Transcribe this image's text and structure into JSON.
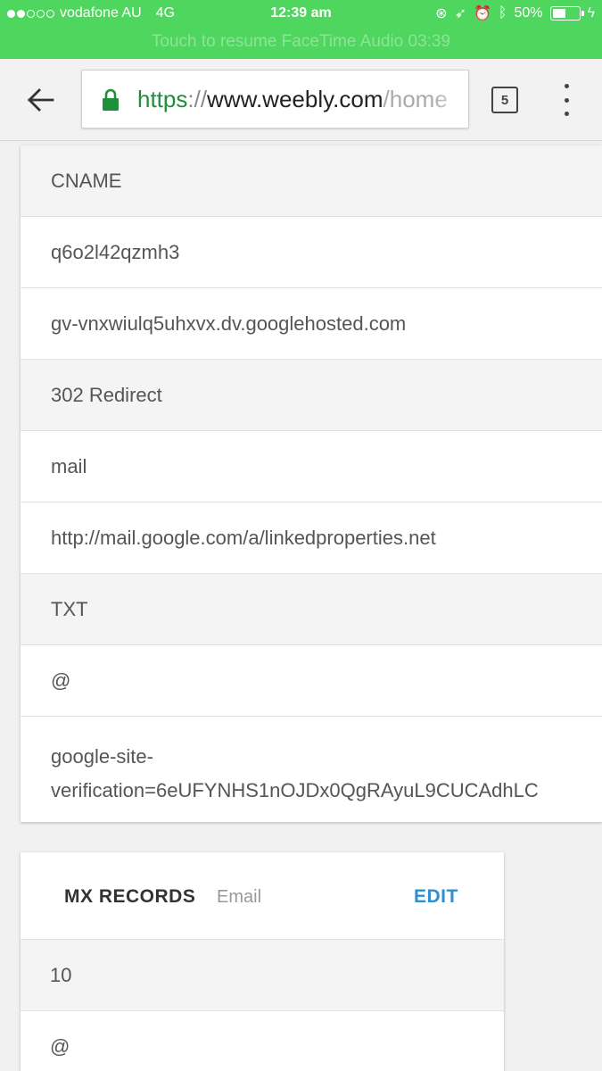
{
  "status_bar": {
    "carrier": "vodafone AU",
    "network": "4G",
    "time": "12:39 am",
    "battery_text": "50%",
    "battery_level": 0.5,
    "banner": "Touch to resume FaceTime Audio 03:39"
  },
  "browser": {
    "url_scheme": "https",
    "url_sep": "://",
    "url_host": "www.weebly.com",
    "url_path": "/home",
    "tab_count": "5"
  },
  "dns_records": [
    {
      "value": "CNAME",
      "shaded": true
    },
    {
      "value": "q6o2l42qzmh3",
      "shaded": false
    },
    {
      "value": "gv-vnxwiulq5uhxvx.dv.googlehosted.com",
      "shaded": false
    },
    {
      "value": "302 Redirect",
      "shaded": true
    },
    {
      "value": "mail",
      "shaded": false
    },
    {
      "value": "http://mail.google.com/a/linkedproperties.net",
      "shaded": false
    },
    {
      "value": "TXT",
      "shaded": true
    },
    {
      "value": "@",
      "shaded": false
    },
    {
      "value_line1": "google-site-",
      "value_line2": "verification=6eUFYNHS1nOJDx0QgRAyuL9CUCAdhLC",
      "shaded": false
    }
  ],
  "mx": {
    "title": "MX RECORDS",
    "subtitle": "Email",
    "edit_label": "EDIT",
    "rows": [
      "10",
      "@"
    ]
  },
  "colors": {
    "status_green": "#4fd65f",
    "secure_green": "#1d8f3a",
    "link_blue": "#2f8fd1"
  }
}
